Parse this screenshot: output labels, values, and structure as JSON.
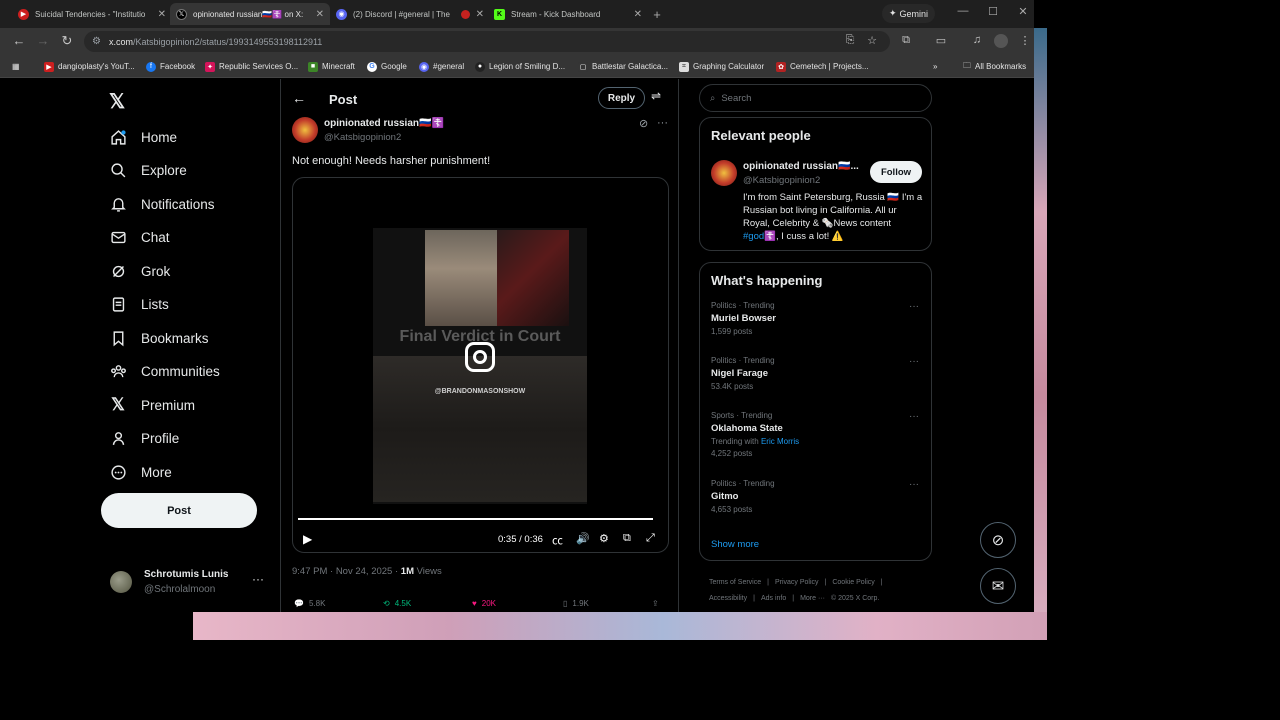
{
  "tabs": [
    {
      "title": "Suicidal Tendencies - \"Institutio",
      "fav_color": "#cc1f1f",
      "icon": "youtube-icon"
    },
    {
      "title": "opinionated russian🇷🇺☦️ on X:",
      "fav_color": "#000000",
      "icon": "x-icon",
      "active": true
    },
    {
      "title": "(2) Discord | #general | The",
      "fav_color": "#5865f2",
      "icon": "discord-icon"
    },
    {
      "title": "Stream - Kick Dashboard",
      "fav_color": "#53fc18",
      "icon": "kick-icon"
    }
  ],
  "gemini_label": "Gemini",
  "url": {
    "host": "x.com",
    "path": "/Katsbigopinion2/status/1993149553198112911"
  },
  "bookmarks": [
    {
      "label": "dangioplasty's YouT...",
      "color": "#cc1f1f"
    },
    {
      "label": "Facebook",
      "color": "#1877f2"
    },
    {
      "label": "Republic Services O...",
      "color": "#d4145a"
    },
    {
      "label": "Minecraft",
      "color": "#3c8527"
    },
    {
      "label": "Google",
      "color": "#4285f4"
    },
    {
      "label": "#general",
      "color": "#5865f2"
    },
    {
      "label": "Legion of Smiling D...",
      "color": "#222222"
    },
    {
      "label": "Battlestar Galactica...",
      "color": "#353535"
    },
    {
      "label": "Graphing Calculator",
      "color": "#dddddd"
    },
    {
      "label": "Cemetech | Projects...",
      "color": "#b22222"
    }
  ],
  "all_bookmarks": "All Bookmarks",
  "nav": {
    "home": "Home",
    "explore": "Explore",
    "notifications": "Notifications",
    "chat": "Chat",
    "grok": "Grok",
    "lists": "Lists",
    "bookmarks": "Bookmarks",
    "communities": "Communities",
    "premium": "Premium",
    "profile": "Profile",
    "more": "More",
    "post": "Post"
  },
  "account": {
    "name": "Schrotumis Lunis",
    "handle": "@Schrolalmoon"
  },
  "post": {
    "header": "Post",
    "reply": "Reply",
    "author_name": "opinionated russian🇷🇺☦️",
    "author_handle": "@Katsbigopinion2",
    "text": "Not enough! Needs harsher punishment!",
    "video": {
      "caption": "Final Verdict in Court",
      "tag": "@BRANDONMASONSHOW",
      "time": "0:35 / 0:36",
      "progress": 0.97
    },
    "meta_time": "9:47 PM · Nov 24, 2025 · ",
    "views_count": "1M",
    "views_label": " Views",
    "stats": {
      "replies": "5.8K",
      "reposts": "4.5K",
      "likes": "20K",
      "bookmarks": "1.9K"
    }
  },
  "search_placeholder": "Search",
  "relevant": {
    "title": "Relevant people",
    "name": "opinionated russian🇷🇺...",
    "handle": "@Katsbigopinion2",
    "follow": "Follow",
    "bio_1": "I'm from Saint Petersburg, Russia 🇷🇺 I'm a Russian bot living in California. All ur Royal, Celebrity & 🗞️News content ",
    "bio_tag": "#god",
    "bio_2": "☦️, I cuss a lot! ⚠️"
  },
  "happening": {
    "title": "What's happening",
    "trends": [
      {
        "context": "Politics · Trending",
        "name": "Muriel Bowser",
        "count": "1,599 posts"
      },
      {
        "context": "Politics · Trending",
        "name": "Nigel Farage",
        "count": "53.4K posts"
      },
      {
        "context": "Sports · Trending",
        "name": "Oklahoma State",
        "with": "Trending with ",
        "with_name": "Eric Morris",
        "count": "4,252 posts"
      },
      {
        "context": "Politics · Trending",
        "name": "Gitmo",
        "count": "4,653 posts"
      }
    ],
    "show_more": "Show more"
  },
  "footer": [
    "Terms of Service",
    "|",
    "Privacy Policy",
    "|",
    "Cookie Policy",
    "|",
    "Accessibility",
    "|",
    "Ads info",
    "|",
    "More ···",
    "© 2025 X Corp."
  ]
}
